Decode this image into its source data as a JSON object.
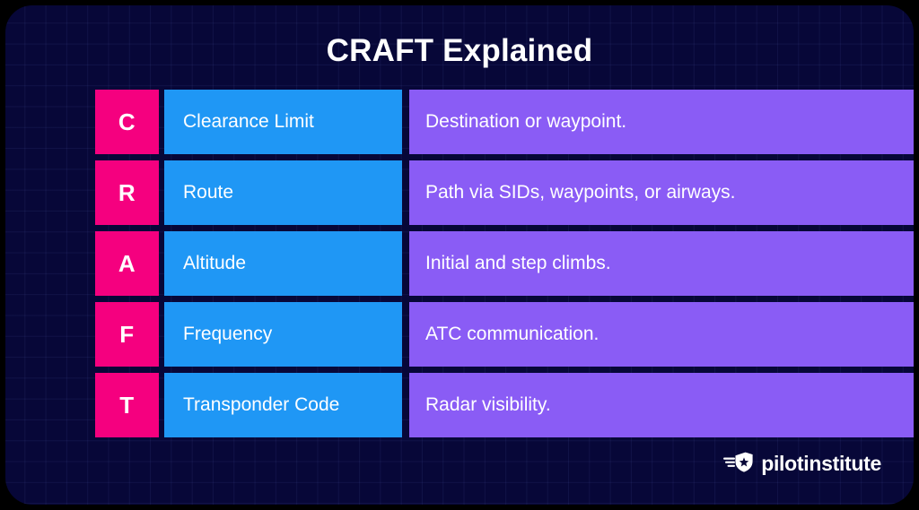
{
  "card": {
    "title": "CRAFT Explained",
    "background_color": "#070738",
    "accent_colors": {
      "letter": "#F5007F",
      "label": "#1F97F5",
      "description": "#8A5CF5"
    }
  },
  "rows": [
    {
      "letter": "C",
      "label": "Clearance Limit",
      "description": "Destination or waypoint.",
      "desc_width": 570
    },
    {
      "letter": "R",
      "label": "Route",
      "description": "Path via SIDs, waypoints, or airways.",
      "desc_width": 573
    },
    {
      "letter": "A",
      "label": "Altitude",
      "description": "Initial and step climbs.",
      "desc_width": 570
    },
    {
      "letter": "F",
      "label": "Frequency",
      "description": "ATC communication.",
      "desc_width": 568
    },
    {
      "letter": "T",
      "label": "Transponder Code",
      "description": "Radar visibility.",
      "desc_width": 570
    }
  ],
  "logo": {
    "text": "pilotinstitute",
    "mark": "winged-shield-star-icon"
  }
}
